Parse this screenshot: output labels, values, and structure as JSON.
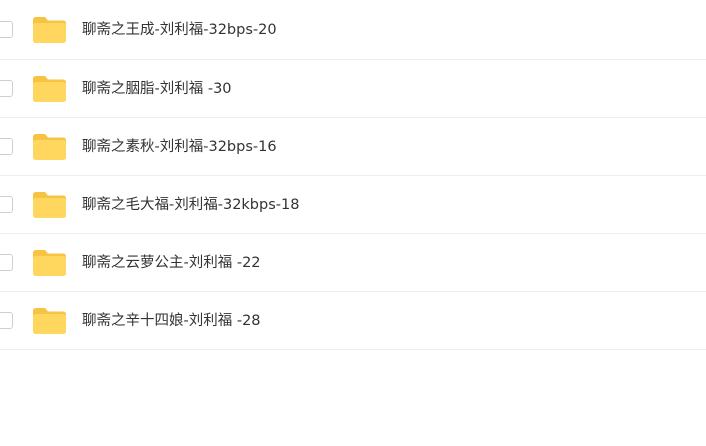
{
  "file_list": {
    "items": [
      {
        "name": "聊斋之王成-刘利福-32bps-20",
        "icon": "folder-icon"
      },
      {
        "name": "聊斋之胭脂-刘利福 -30",
        "icon": "folder-icon"
      },
      {
        "name": "聊斋之素秋-刘利福-32bps-16",
        "icon": "folder-icon"
      },
      {
        "name": "聊斋之毛大福-刘利福-32kbps-18",
        "icon": "folder-icon"
      },
      {
        "name": "聊斋之云萝公主-刘利福 -22",
        "icon": "folder-icon"
      },
      {
        "name": "聊斋之辛十四娘-刘利福 -28",
        "icon": "folder-icon"
      }
    ]
  },
  "colors": {
    "folder_body": "#FFD75E",
    "folder_tab": "#F6C343",
    "text": "#333333",
    "divider": "#EEEEEE"
  }
}
